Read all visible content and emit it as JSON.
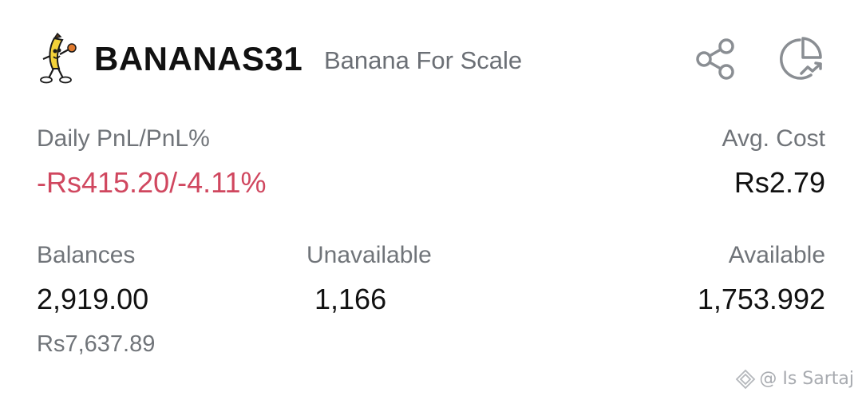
{
  "header": {
    "symbol": "BANANAS31",
    "name": "Banana For Scale",
    "logo_icon": "banana-mascot-icon",
    "share_icon": "share-icon",
    "chart_icon": "pie-chart-trend-icon"
  },
  "pnl": {
    "label": "Daily PnL/PnL%",
    "value": "-Rs415.20/-4.11%",
    "color": "#d0475f"
  },
  "avg_cost": {
    "label": "Avg. Cost",
    "value": "Rs2.79"
  },
  "balances": {
    "label": "Balances",
    "value": "2,919.00",
    "fiat_value": "Rs7,637.89"
  },
  "unavailable": {
    "label": "Unavailable",
    "value": "1,166"
  },
  "available": {
    "label": "Available",
    "value": "1,753.992"
  },
  "watermark": {
    "text": "@ Is Sartaj",
    "icon": "binance-diamond-icon"
  }
}
